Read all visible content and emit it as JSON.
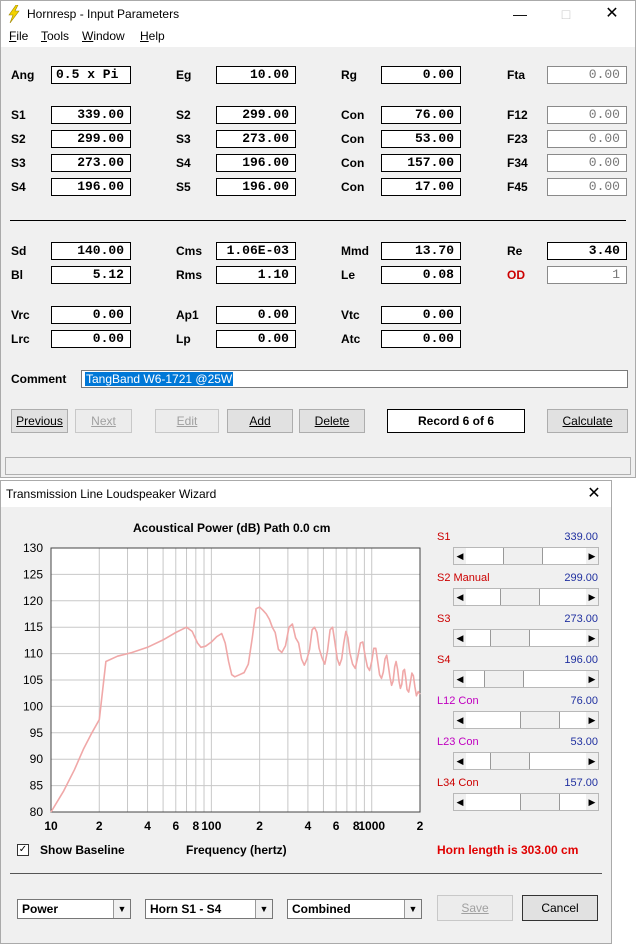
{
  "w1": {
    "title": "Hornresp - Input Parameters",
    "menu": [
      {
        "u": "F",
        "rest": "ile"
      },
      {
        "u": "T",
        "rest": "ools"
      },
      {
        "u": "W",
        "rest": "indow"
      },
      {
        "u": "H",
        "rest": "elp"
      }
    ],
    "fields": {
      "ang": {
        "label": "Ang",
        "value": "0.5 x Pi"
      },
      "eg": {
        "label": "Eg",
        "value": "10.00"
      },
      "rg": {
        "label": "Rg",
        "value": "0.00"
      },
      "fta": {
        "label": "Fta",
        "value": "0.00"
      },
      "s1": {
        "label": "S1",
        "value": "339.00"
      },
      "s2b": {
        "label": "S2",
        "value": "299.00"
      },
      "con1": {
        "label": "Con",
        "value": "76.00"
      },
      "f12": {
        "label": "F12",
        "value": "0.00"
      },
      "s2": {
        "label": "S2",
        "value": "299.00"
      },
      "s3b": {
        "label": "S3",
        "value": "273.00"
      },
      "con2": {
        "label": "Con",
        "value": "53.00"
      },
      "f23": {
        "label": "F23",
        "value": "0.00"
      },
      "s3": {
        "label": "S3",
        "value": "273.00"
      },
      "s4b": {
        "label": "S4",
        "value": "196.00"
      },
      "con3": {
        "label": "Con",
        "value": "157.00"
      },
      "f34": {
        "label": "F34",
        "value": "0.00"
      },
      "s4": {
        "label": "S4",
        "value": "196.00"
      },
      "s5": {
        "label": "S5",
        "value": "196.00"
      },
      "con4": {
        "label": "Con",
        "value": "17.00"
      },
      "f45": {
        "label": "F45",
        "value": "0.00"
      },
      "sd": {
        "label": "Sd",
        "value": "140.00"
      },
      "cms": {
        "label": "Cms",
        "value": "1.06E-03"
      },
      "mmd": {
        "label": "Mmd",
        "value": "13.70"
      },
      "re": {
        "label": "Re",
        "value": "3.40"
      },
      "bl": {
        "label": "Bl",
        "value": "5.12"
      },
      "rms": {
        "label": "Rms",
        "value": "1.10"
      },
      "le": {
        "label": "Le",
        "value": "0.08"
      },
      "od": {
        "label": "OD",
        "value": "1"
      },
      "vrc": {
        "label": "Vrc",
        "value": "0.00"
      },
      "ap1": {
        "label": "Ap1",
        "value": "0.00"
      },
      "vtc": {
        "label": "Vtc",
        "value": "0.00"
      },
      "lrc": {
        "label": "Lrc",
        "value": "0.00"
      },
      "lp": {
        "label": "Lp",
        "value": "0.00"
      },
      "atc": {
        "label": "Atc",
        "value": "0.00"
      }
    },
    "comment_label": "Comment",
    "comment_value": "TangBand W6-1721 @25W",
    "buttons": {
      "previous": "Previous",
      "next": "Next",
      "edit": "Edit",
      "add": "Add",
      "delete": "Delete",
      "record": "Record 6 of 6",
      "calculate": "Calculate"
    }
  },
  "w2": {
    "title": "Transmission Line Loudspeaker Wizard",
    "chart_title": "Acoustical Power (dB)   Path 0.0 cm",
    "xlabel": "Frequency (hertz)",
    "show_baseline": "Show Baseline",
    "show_baseline_checked": true,
    "horn_length": "Horn length is 303.00 cm",
    "sliders": [
      {
        "label": "S1",
        "value": "339.00",
        "color": "#cc0000",
        "pos": 0.46
      },
      {
        "label": "S2  Manual",
        "value": "299.00",
        "color": "#cc0000",
        "pos": 0.43
      },
      {
        "label": "S3",
        "value": "273.00",
        "color": "#cc0000",
        "pos": 0.3
      },
      {
        "label": "S4",
        "value": "196.00",
        "color": "#cc0000",
        "pos": 0.23
      },
      {
        "label": "L12  Con",
        "value": "76.00",
        "color": "#c000c0",
        "pos": 0.68
      },
      {
        "label": "L23  Con",
        "value": "53.00",
        "color": "#c000c0",
        "pos": 0.3
      },
      {
        "label": "L34  Con",
        "value": "157.00",
        "color": "#cc0000",
        "pos": 0.68
      }
    ],
    "combos": {
      "power": "Power",
      "horn": "Horn S1 - S4",
      "combined": "Combined"
    },
    "buttons": {
      "save": "Save",
      "cancel": "Cancel"
    }
  },
  "chart_data": {
    "type": "line",
    "title": "Acoustical Power (dB)   Path 0.0 cm",
    "xlabel": "Frequency (hertz)",
    "ylabel": "",
    "xscale": "log",
    "xlim": [
      10,
      2000
    ],
    "ylim": [
      80,
      130
    ],
    "yticks": [
      80,
      85,
      90,
      95,
      100,
      105,
      110,
      115,
      120,
      125,
      130
    ],
    "xticks": [
      {
        "v": 10,
        "label": "10"
      },
      {
        "v": 20,
        "label": "2"
      },
      {
        "v": 40,
        "label": "4"
      },
      {
        "v": 60,
        "label": "6"
      },
      {
        "v": 80,
        "label": "8"
      },
      {
        "v": 100,
        "label": "100"
      },
      {
        "v": 200,
        "label": "2"
      },
      {
        "v": 400,
        "label": "4"
      },
      {
        "v": 600,
        "label": "6"
      },
      {
        "v": 800,
        "label": "8"
      },
      {
        "v": 1000,
        "label": "1000"
      },
      {
        "v": 2000,
        "label": "2"
      }
    ],
    "grid": true,
    "series": [
      {
        "color": "#f0a8a8",
        "points": [
          [
            10,
            80
          ],
          [
            12,
            84
          ],
          [
            14,
            88
          ],
          [
            16,
            92
          ],
          [
            18,
            95
          ],
          [
            20,
            97.5
          ],
          [
            22,
            108.5
          ],
          [
            26,
            109.5
          ],
          [
            32,
            110.2
          ],
          [
            40,
            111.2
          ],
          [
            50,
            112.6
          ],
          [
            60,
            114
          ],
          [
            70,
            115
          ],
          [
            76,
            114.2
          ],
          [
            82,
            112
          ],
          [
            86,
            111.2
          ],
          [
            92,
            111.4
          ],
          [
            100,
            112.2
          ],
          [
            108,
            113.2
          ],
          [
            116,
            113.8
          ],
          [
            122,
            112
          ],
          [
            128,
            108.5
          ],
          [
            134,
            106
          ],
          [
            140,
            105.6
          ],
          [
            150,
            106
          ],
          [
            160,
            106.4
          ],
          [
            170,
            108
          ],
          [
            180,
            113
          ],
          [
            190,
            118.5
          ],
          [
            200,
            118.8
          ],
          [
            210,
            118.2
          ],
          [
            220,
            117.5
          ],
          [
            230,
            116.5
          ],
          [
            240,
            115
          ],
          [
            250,
            114
          ],
          [
            262,
            110.8
          ],
          [
            275,
            110.2
          ],
          [
            290,
            111.5
          ],
          [
            305,
            115
          ],
          [
            320,
            115.6
          ],
          [
            335,
            113
          ],
          [
            350,
            112
          ],
          [
            365,
            109
          ],
          [
            380,
            107.8
          ],
          [
            395,
            109
          ],
          [
            410,
            110.8
          ],
          [
            425,
            114.5
          ],
          [
            440,
            115
          ],
          [
            455,
            114
          ],
          [
            470,
            111
          ],
          [
            490,
            109.2
          ],
          [
            510,
            108
          ],
          [
            530,
            110.5
          ],
          [
            550,
            114.5
          ],
          [
            570,
            115
          ],
          [
            590,
            112
          ],
          [
            610,
            109
          ],
          [
            630,
            107.8
          ],
          [
            650,
            109
          ],
          [
            670,
            112
          ],
          [
            690,
            114.2
          ],
          [
            710,
            113
          ],
          [
            730,
            110.2
          ],
          [
            760,
            108
          ],
          [
            790,
            107.2
          ],
          [
            820,
            109.5
          ],
          [
            850,
            112
          ],
          [
            880,
            112.2
          ],
          [
            910,
            109.5
          ],
          [
            940,
            107.5
          ],
          [
            970,
            106.8
          ],
          [
            1000,
            108.5
          ],
          [
            1030,
            111
          ],
          [
            1060,
            111
          ],
          [
            1090,
            108.5
          ],
          [
            1120,
            106
          ],
          [
            1150,
            105.3
          ],
          [
            1180,
            106.5
          ],
          [
            1210,
            109
          ],
          [
            1240,
            109.7
          ],
          [
            1270,
            107.6
          ],
          [
            1300,
            105.5
          ],
          [
            1330,
            104
          ],
          [
            1360,
            104.8
          ],
          [
            1390,
            107.5
          ],
          [
            1420,
            108.5
          ],
          [
            1450,
            107
          ],
          [
            1480,
            104.8
          ],
          [
            1510,
            103.4
          ],
          [
            1540,
            104.2
          ],
          [
            1570,
            106.7
          ],
          [
            1600,
            107
          ],
          [
            1630,
            105.3
          ],
          [
            1660,
            103.2
          ],
          [
            1700,
            102.7
          ],
          [
            1740,
            104.5
          ],
          [
            1780,
            106.3
          ],
          [
            1820,
            105.8
          ],
          [
            1860,
            103.7
          ],
          [
            1900,
            102
          ],
          [
            1950,
            102.8
          ],
          [
            2000,
            102.3
          ]
        ]
      }
    ]
  }
}
